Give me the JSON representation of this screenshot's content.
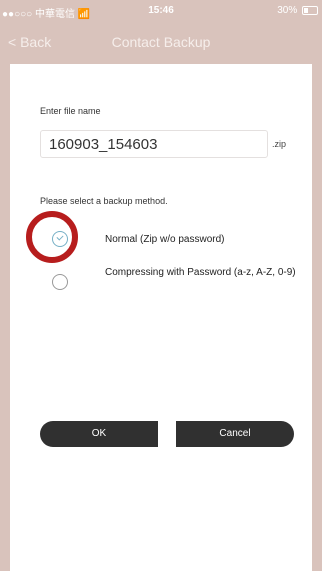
{
  "status_bar": {
    "carrier": "●●○○○ 中華電信",
    "wifi_icon": "wifi-icon",
    "time": "15:46",
    "battery_text": "30%",
    "battery_icon": "battery-icon"
  },
  "nav": {
    "back_label": "< Back",
    "title": "Contact Backup"
  },
  "form": {
    "file_name_label": "Enter file name",
    "file_name_value": "160903_154603",
    "extension": ".zip",
    "method_label": "Please select a backup method.",
    "options": [
      {
        "label": "Normal (Zip w/o password)",
        "selected": true
      },
      {
        "label": "Compressing  with Password (a-z, A-Z, 0-9)",
        "selected": false
      }
    ]
  },
  "buttons": {
    "ok": "OK",
    "cancel": "Cancel"
  },
  "colors": {
    "background": "#d9c3bc",
    "panel": "#ffffff",
    "button": "#303030",
    "radio_selected": "#76b0c6",
    "highlight_ring": "#b71d1d"
  }
}
